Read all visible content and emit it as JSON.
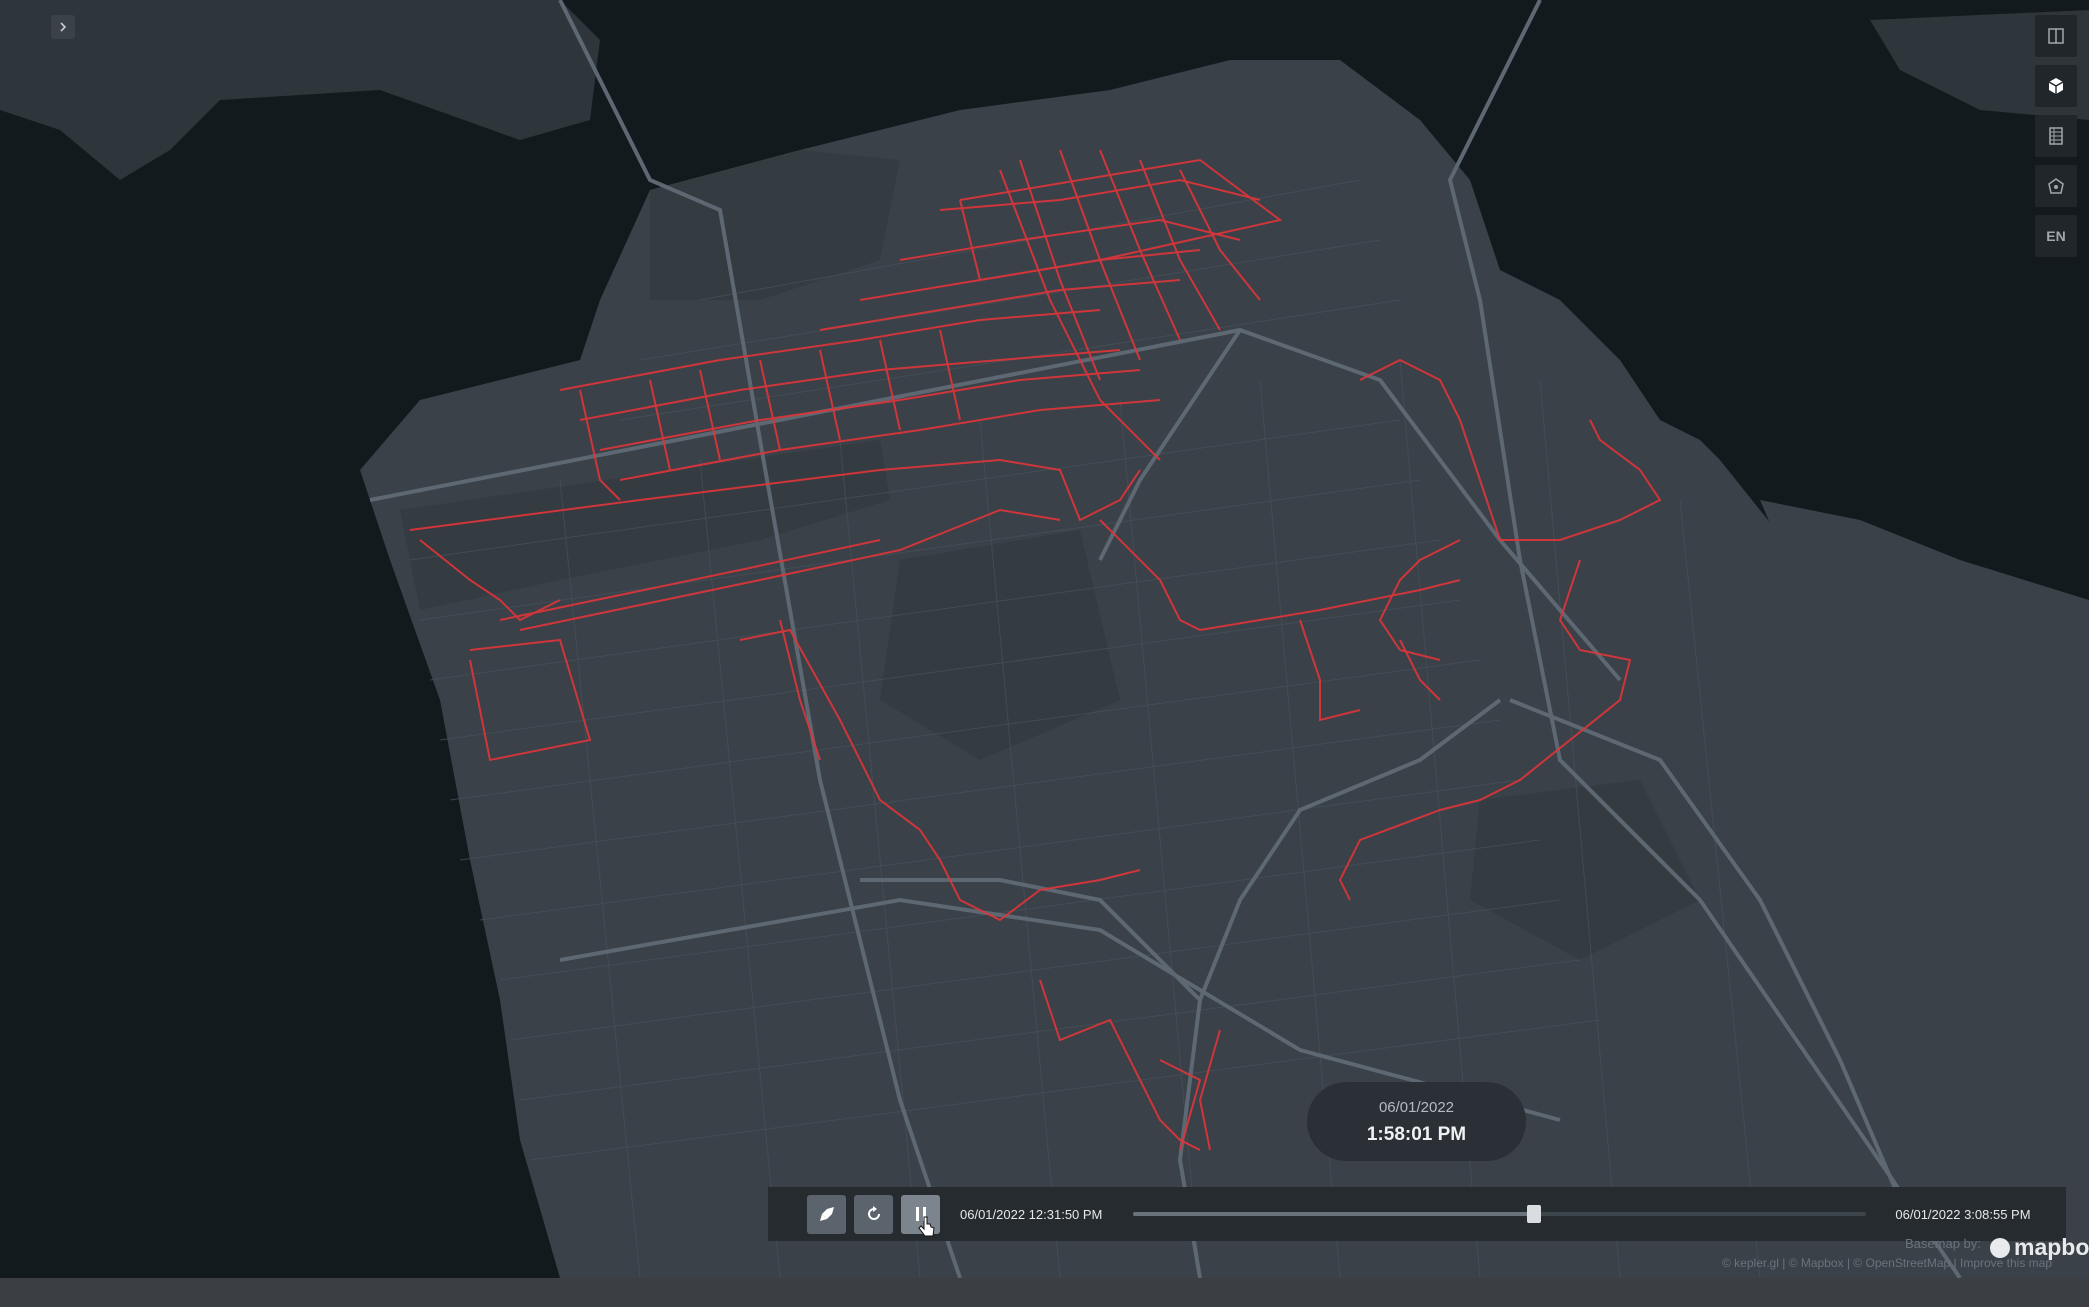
{
  "sidebar": {
    "expand_icon": "chevron-right-icon"
  },
  "map_controls": [
    {
      "name": "split-map-icon",
      "active": false
    },
    {
      "name": "3d-view-icon",
      "active": true
    },
    {
      "name": "legend-icon",
      "active": false
    },
    {
      "name": "draw-polygon-icon",
      "active": false
    }
  ],
  "locale": {
    "label": "EN"
  },
  "time_display": {
    "date": "06/01/2022",
    "time": "1:58:01 PM"
  },
  "playback": {
    "buttons": [
      "speed-rocket-icon",
      "reset-icon",
      "pause-icon"
    ],
    "start_label": "06/01/2022 12:31:50 PM",
    "end_label": "06/01/2022 3:08:55 PM",
    "progress": 0.547
  },
  "attribution": {
    "basemap_label": "Basemap by:",
    "logo": "mapbox",
    "text": "© kepler.gl | © Mapbox | © OpenStreetMap | Improve this map"
  },
  "colors": {
    "water": "#121a1d",
    "land": "#3a4148",
    "park": "#343b41",
    "road": "#56616b",
    "trip_path": "#e0353a"
  }
}
